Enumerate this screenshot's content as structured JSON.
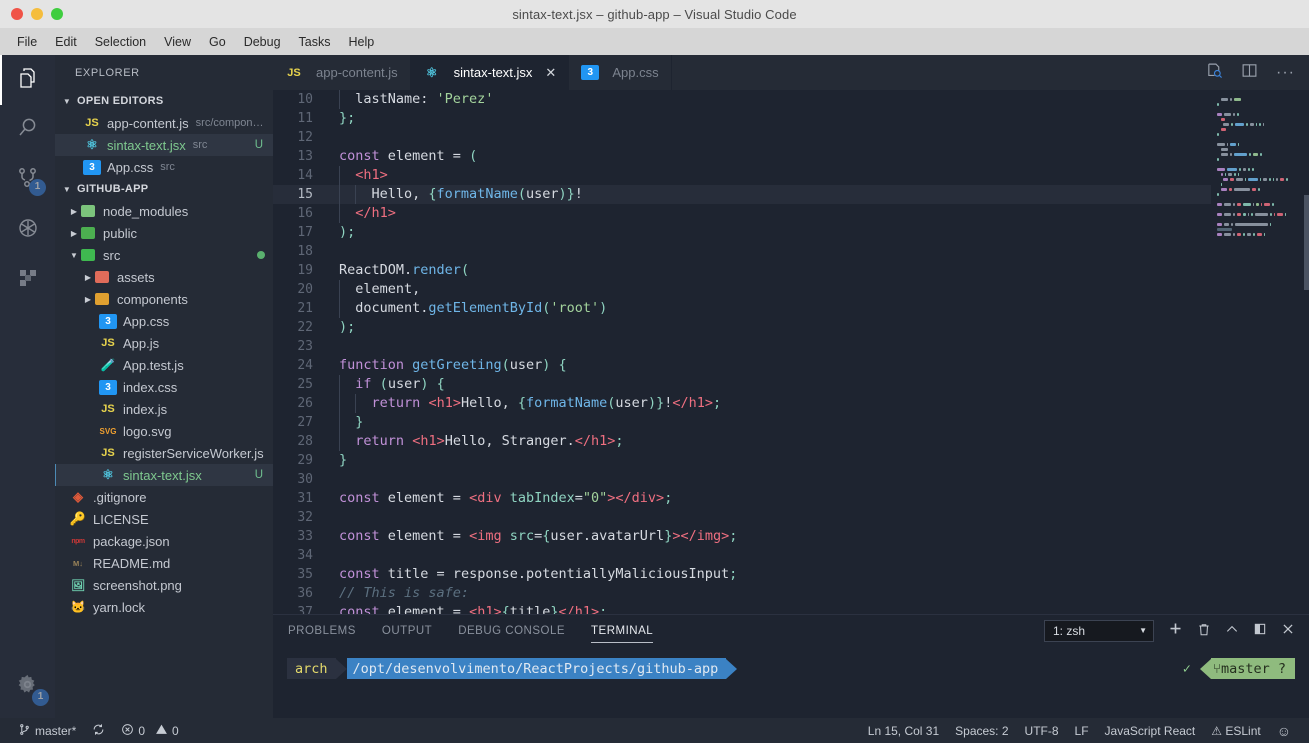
{
  "window": {
    "title": "sintax-text.jsx – github-app – Visual Studio Code",
    "traffic_lights": [
      "close",
      "minimize",
      "zoom"
    ]
  },
  "menubar": {
    "items": [
      "File",
      "Edit",
      "Selection",
      "View",
      "Go",
      "Debug",
      "Tasks",
      "Help"
    ]
  },
  "activitybar": {
    "items": [
      {
        "name": "explorer",
        "icon": "files-icon",
        "active": true,
        "badge": ""
      },
      {
        "name": "search",
        "icon": "search-icon",
        "active": false,
        "badge": ""
      },
      {
        "name": "source-control",
        "icon": "source-control-icon",
        "active": false,
        "badge": "1"
      },
      {
        "name": "debug",
        "icon": "debug-icon",
        "active": false,
        "badge": ""
      },
      {
        "name": "extensions",
        "icon": "extensions-icon",
        "active": false,
        "badge": ""
      }
    ],
    "settings": {
      "name": "manage",
      "icon": "gear-icon",
      "badge": "1"
    }
  },
  "sidebar": {
    "title": "EXPLORER",
    "open_editors": {
      "label": "OPEN EDITORS",
      "items": [
        {
          "icon": "js-icon",
          "name": "app-content.js",
          "path": "src/compon…",
          "flag": ""
        },
        {
          "icon": "react-icon",
          "name": "sintax-text.jsx",
          "path": "src",
          "flag": "U"
        },
        {
          "icon": "css-icon",
          "name": "App.css",
          "path": "src",
          "flag": ""
        }
      ]
    },
    "project": {
      "label": "GITHUB-APP",
      "items": [
        {
          "icon": "folder-icon",
          "name": "node_modules",
          "indent": 2,
          "folder": true,
          "flag": "",
          "color": "#7cc47c"
        },
        {
          "icon": "folder-icon",
          "name": "public",
          "indent": 2,
          "folder": true,
          "flag": "",
          "color": "#4caf50"
        },
        {
          "icon": "folder-icon",
          "name": "src",
          "indent": 2,
          "folder": true,
          "expanded": true,
          "flag": "",
          "modified": true,
          "color": "#3fb950"
        },
        {
          "icon": "folder-icon",
          "name": "assets",
          "indent": 3,
          "folder": true,
          "flag": "",
          "color": "#e06c5a"
        },
        {
          "icon": "folder-icon",
          "name": "components",
          "indent": 3,
          "folder": true,
          "flag": "",
          "color": "#e0a030"
        },
        {
          "icon": "css-icon",
          "name": "App.css",
          "indent": 4,
          "flag": ""
        },
        {
          "icon": "js-icon",
          "name": "App.js",
          "indent": 4,
          "flag": ""
        },
        {
          "icon": "test-icon",
          "name": "App.test.js",
          "indent": 4,
          "flag": ""
        },
        {
          "icon": "css-icon",
          "name": "index.css",
          "indent": 4,
          "flag": ""
        },
        {
          "icon": "js-icon",
          "name": "index.js",
          "indent": 4,
          "flag": ""
        },
        {
          "icon": "svg-icon",
          "name": "logo.svg",
          "indent": 4,
          "flag": ""
        },
        {
          "icon": "js-icon",
          "name": "registerServiceWorker.js",
          "indent": 4,
          "flag": ""
        },
        {
          "icon": "react-icon",
          "name": "sintax-text.jsx",
          "indent": 4,
          "flag": "U",
          "selected": true
        },
        {
          "icon": "git-icon",
          "name": ".gitignore",
          "indent": 2,
          "flag": ""
        },
        {
          "icon": "license-icon",
          "name": "LICENSE",
          "indent": 2,
          "flag": ""
        },
        {
          "icon": "npm-icon",
          "name": "package.json",
          "indent": 2,
          "flag": ""
        },
        {
          "icon": "markdown-icon",
          "name": "README.md",
          "indent": 2,
          "flag": ""
        },
        {
          "icon": "image-icon",
          "name": "screenshot.png",
          "indent": 2,
          "flag": ""
        },
        {
          "icon": "yarn-icon",
          "name": "yarn.lock",
          "indent": 2,
          "flag": ""
        }
      ]
    }
  },
  "tabs": {
    "items": [
      {
        "icon": "js-icon",
        "label": "app-content.js",
        "active": false,
        "dirty": false
      },
      {
        "icon": "react-icon",
        "label": "sintax-text.jsx",
        "active": true,
        "close": "✕"
      },
      {
        "icon": "css-icon",
        "label": "App.css",
        "active": false
      }
    ],
    "actions": [
      {
        "name": "open-changes-icon",
        "glyph": "⧉"
      },
      {
        "name": "split-editor-icon",
        "glyph": "▥"
      },
      {
        "name": "more-actions-icon",
        "glyph": "···"
      }
    ]
  },
  "editor": {
    "first_line_number": 10,
    "highlighted_line": 15,
    "lines": [
      {
        "n": 10,
        "tokens": [
          {
            "t": "  lastName",
            "c": "plain"
          },
          {
            "t": ": ",
            "c": "plain"
          },
          {
            "t": "'Perez'",
            "c": "str"
          }
        ]
      },
      {
        "n": 11,
        "tokens": [
          {
            "t": "};",
            "c": "punc"
          }
        ]
      },
      {
        "n": 12,
        "tokens": []
      },
      {
        "n": 13,
        "tokens": [
          {
            "t": "const",
            "c": "key"
          },
          {
            "t": " element ",
            "c": "plain"
          },
          {
            "t": "= ",
            "c": "plain"
          },
          {
            "t": "(",
            "c": "punc"
          }
        ]
      },
      {
        "n": 14,
        "tokens": [
          {
            "t": "  ",
            "c": "plain"
          },
          {
            "t": "<h1>",
            "c": "tag"
          }
        ]
      },
      {
        "n": 15,
        "tokens": [
          {
            "t": "    Hello, ",
            "c": "plain"
          },
          {
            "t": "{",
            "c": "punc"
          },
          {
            "t": "formatName",
            "c": "fn"
          },
          {
            "t": "(",
            "c": "punc"
          },
          {
            "t": "user",
            "c": "plain"
          },
          {
            "t": ")",
            "c": "punc"
          },
          {
            "t": "}",
            "c": "punc"
          },
          {
            "t": "!",
            "c": "plain"
          }
        ]
      },
      {
        "n": 16,
        "tokens": [
          {
            "t": "  ",
            "c": "plain"
          },
          {
            "t": "</h1>",
            "c": "tag"
          }
        ]
      },
      {
        "n": 17,
        "tokens": [
          {
            "t": ");",
            "c": "punc"
          }
        ]
      },
      {
        "n": 18,
        "tokens": []
      },
      {
        "n": 19,
        "tokens": [
          {
            "t": "ReactDOM",
            "c": "plain"
          },
          {
            "t": ".",
            "c": "plain"
          },
          {
            "t": "render",
            "c": "fn"
          },
          {
            "t": "(",
            "c": "punc"
          }
        ]
      },
      {
        "n": 20,
        "tokens": [
          {
            "t": "  element,",
            "c": "plain"
          }
        ]
      },
      {
        "n": 21,
        "tokens": [
          {
            "t": "  document",
            "c": "plain"
          },
          {
            "t": ".",
            "c": "plain"
          },
          {
            "t": "getElementById",
            "c": "fn"
          },
          {
            "t": "(",
            "c": "punc"
          },
          {
            "t": "'root'",
            "c": "str"
          },
          {
            "t": ")",
            "c": "punc"
          }
        ]
      },
      {
        "n": 22,
        "tokens": [
          {
            "t": ");",
            "c": "punc"
          }
        ]
      },
      {
        "n": 23,
        "tokens": []
      },
      {
        "n": 24,
        "tokens": [
          {
            "t": "function",
            "c": "key"
          },
          {
            "t": " ",
            "c": "plain"
          },
          {
            "t": "getGreeting",
            "c": "fn"
          },
          {
            "t": "(",
            "c": "punc"
          },
          {
            "t": "user",
            "c": "plain"
          },
          {
            "t": ") ",
            "c": "punc"
          },
          {
            "t": "{",
            "c": "punc"
          }
        ]
      },
      {
        "n": 25,
        "tokens": [
          {
            "t": "  ",
            "c": "plain"
          },
          {
            "t": "if",
            "c": "key"
          },
          {
            "t": " ",
            "c": "plain"
          },
          {
            "t": "(",
            "c": "punc"
          },
          {
            "t": "user",
            "c": "plain"
          },
          {
            "t": ") ",
            "c": "punc"
          },
          {
            "t": "{",
            "c": "punc"
          }
        ]
      },
      {
        "n": 26,
        "tokens": [
          {
            "t": "    ",
            "c": "plain"
          },
          {
            "t": "return",
            "c": "key"
          },
          {
            "t": " ",
            "c": "plain"
          },
          {
            "t": "<h1>",
            "c": "tag"
          },
          {
            "t": "Hello, ",
            "c": "plain"
          },
          {
            "t": "{",
            "c": "punc"
          },
          {
            "t": "formatName",
            "c": "fn"
          },
          {
            "t": "(",
            "c": "punc"
          },
          {
            "t": "user",
            "c": "plain"
          },
          {
            "t": ")",
            "c": "punc"
          },
          {
            "t": "}",
            "c": "punc"
          },
          {
            "t": "!",
            "c": "plain"
          },
          {
            "t": "</h1>",
            "c": "tag"
          },
          {
            "t": ";",
            "c": "punc"
          }
        ]
      },
      {
        "n": 27,
        "tokens": [
          {
            "t": "  ",
            "c": "plain"
          },
          {
            "t": "}",
            "c": "punc"
          }
        ]
      },
      {
        "n": 28,
        "tokens": [
          {
            "t": "  ",
            "c": "plain"
          },
          {
            "t": "return",
            "c": "key"
          },
          {
            "t": " ",
            "c": "plain"
          },
          {
            "t": "<h1>",
            "c": "tag"
          },
          {
            "t": "Hello, Stranger.",
            "c": "plain"
          },
          {
            "t": "</h1>",
            "c": "tag"
          },
          {
            "t": ";",
            "c": "punc"
          }
        ]
      },
      {
        "n": 29,
        "tokens": [
          {
            "t": "}",
            "c": "punc"
          }
        ]
      },
      {
        "n": 30,
        "tokens": []
      },
      {
        "n": 31,
        "tokens": [
          {
            "t": "const",
            "c": "key"
          },
          {
            "t": " element ",
            "c": "plain"
          },
          {
            "t": "= ",
            "c": "plain"
          },
          {
            "t": "<div",
            "c": "tag"
          },
          {
            "t": " ",
            "c": "plain"
          },
          {
            "t": "tabIndex",
            "c": "attr"
          },
          {
            "t": "=",
            "c": "plain"
          },
          {
            "t": "\"0\"",
            "c": "str"
          },
          {
            "t": ">",
            "c": "tag"
          },
          {
            "t": "</div>",
            "c": "tag"
          },
          {
            "t": ";",
            "c": "punc"
          }
        ]
      },
      {
        "n": 32,
        "tokens": []
      },
      {
        "n": 33,
        "tokens": [
          {
            "t": "const",
            "c": "key"
          },
          {
            "t": " element ",
            "c": "plain"
          },
          {
            "t": "= ",
            "c": "plain"
          },
          {
            "t": "<img",
            "c": "tag"
          },
          {
            "t": " ",
            "c": "plain"
          },
          {
            "t": "src",
            "c": "attr"
          },
          {
            "t": "=",
            "c": "plain"
          },
          {
            "t": "{",
            "c": "punc"
          },
          {
            "t": "user.avatarUrl",
            "c": "plain"
          },
          {
            "t": "}",
            "c": "punc"
          },
          {
            "t": ">",
            "c": "tag"
          },
          {
            "t": "</img>",
            "c": "tag"
          },
          {
            "t": ";",
            "c": "punc"
          }
        ]
      },
      {
        "n": 34,
        "tokens": []
      },
      {
        "n": 35,
        "tokens": [
          {
            "t": "const",
            "c": "key"
          },
          {
            "t": " title ",
            "c": "plain"
          },
          {
            "t": "= ",
            "c": "plain"
          },
          {
            "t": "response.potentiallyMaliciousInput",
            "c": "plain"
          },
          {
            "t": ";",
            "c": "punc"
          }
        ]
      },
      {
        "n": 36,
        "tokens": [
          {
            "t": "// This is safe:",
            "c": "com"
          }
        ]
      },
      {
        "n": 37,
        "tokens": [
          {
            "t": "const",
            "c": "key"
          },
          {
            "t": " element ",
            "c": "plain"
          },
          {
            "t": "= ",
            "c": "plain"
          },
          {
            "t": "<h1>",
            "c": "tag"
          },
          {
            "t": "{",
            "c": "punc"
          },
          {
            "t": "title",
            "c": "plain"
          },
          {
            "t": "}",
            "c": "punc"
          },
          {
            "t": "</h1>",
            "c": "tag"
          },
          {
            "t": ";",
            "c": "punc"
          }
        ]
      }
    ]
  },
  "panel": {
    "tabs": [
      {
        "label": "PROBLEMS",
        "active": false
      },
      {
        "label": "OUTPUT",
        "active": false
      },
      {
        "label": "DEBUG CONSOLE",
        "active": false
      },
      {
        "label": "TERMINAL",
        "active": true
      }
    ],
    "terminal_select": {
      "value": "1: zsh",
      "caret": "▼"
    },
    "actions": [
      {
        "name": "new-terminal-icon",
        "glyph": "＋"
      },
      {
        "name": "kill-terminal-icon",
        "glyph": "🗑"
      },
      {
        "name": "maximize-panel-icon",
        "glyph": "⌃"
      },
      {
        "name": "split-terminal-icon",
        "glyph": "▥"
      },
      {
        "name": "close-panel-icon",
        "glyph": "✕"
      }
    ],
    "terminal": {
      "user_segment": "arch",
      "path_segment": "/opt/desenvolvimento/ReactProjects/github-app",
      "status_check": "✓",
      "git_segment": "⑂master ?"
    }
  },
  "statusbar": {
    "left": [
      {
        "name": "branch",
        "icon": "source-control-icon",
        "label": "master*"
      },
      {
        "name": "sync",
        "icon": "sync-icon",
        "label": ""
      },
      {
        "name": "errors",
        "icon": "error-icon",
        "label": "0"
      },
      {
        "name": "warnings",
        "icon": "warning-icon",
        "label": "0"
      }
    ],
    "right": [
      {
        "name": "cursor-position",
        "label": "Ln 15, Col 31"
      },
      {
        "name": "indentation",
        "label": "Spaces: 2"
      },
      {
        "name": "encoding",
        "label": "UTF-8"
      },
      {
        "name": "eol",
        "label": "LF"
      },
      {
        "name": "language-mode",
        "label": "JavaScript React"
      },
      {
        "name": "eslint",
        "label": "⚠ ESLint"
      },
      {
        "name": "feedback",
        "label": "☺"
      }
    ]
  },
  "colors": {
    "titlebar": "#e4e4e4",
    "menubar": "#d6d6d6",
    "sidebar": "#252b36",
    "editor": "#1e2430",
    "accent_blue": "#3b82d8",
    "terminal_path": "#3b82c4",
    "terminal_git": "#8fbb7e"
  }
}
